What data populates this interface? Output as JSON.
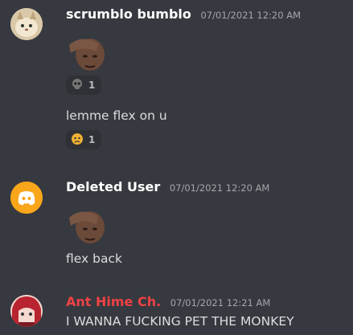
{
  "messages": [
    {
      "username": "scrumblo bumblo",
      "timestamp": "07/01/2021 12:20 AM",
      "username_color": "#ffffff",
      "attachment": "sticker-face",
      "reactions": [
        {
          "emoji": "skull-emoji",
          "count": "1"
        }
      ],
      "text": "lemme flex on u",
      "text_reactions": [
        {
          "emoji": "sad-cat-emoji",
          "count": "1"
        }
      ]
    },
    {
      "username": "Deleted User",
      "timestamp": "07/01/2021 12:20 AM",
      "username_color": "#ffffff",
      "attachment": "sticker-face",
      "text": "flex back"
    },
    {
      "username": "Ant Hime Ch.",
      "timestamp": "07/01/2021 12:21 AM",
      "username_color": "#ed4245",
      "text": "I WANNA FUCKING PET THE MONKEY"
    }
  ],
  "colors": {
    "background": "#36393f",
    "text": "#dcddde",
    "timestamp": "#a3a6aa",
    "reaction_bg": "#2f3136",
    "discord_avatar_bg": "#faa61a"
  }
}
